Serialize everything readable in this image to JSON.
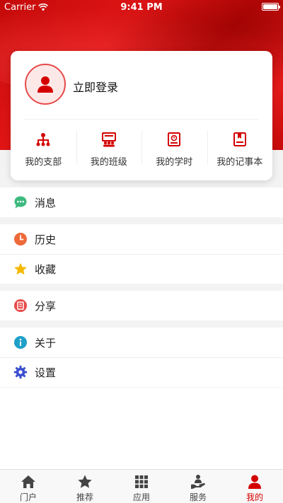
{
  "status_bar": {
    "carrier": "Carrier",
    "time": "9:41 PM"
  },
  "profile": {
    "login_label": "立即登录"
  },
  "shortcuts": [
    {
      "label": "我的支部",
      "icon": "party-emblem-icon"
    },
    {
      "label": "我的班级",
      "icon": "class-icon"
    },
    {
      "label": "我的学时",
      "icon": "study-hours-icon"
    },
    {
      "label": "我的记事本",
      "icon": "notebook-icon"
    }
  ],
  "menu": {
    "messages": {
      "label": "消息",
      "icon": "chat-bubble-icon",
      "color": "#3dba7e"
    },
    "history": {
      "label": "历史",
      "icon": "clock-icon",
      "color": "#ee6a3a"
    },
    "favorites": {
      "label": "收藏",
      "icon": "star-icon",
      "color": "#f5b800"
    },
    "share": {
      "label": "分享",
      "icon": "share-icon",
      "color": "#e94a4a"
    },
    "about": {
      "label": "关于",
      "icon": "info-icon",
      "color": "#1fa0c8"
    },
    "settings": {
      "label": "设置",
      "icon": "gear-icon",
      "color": "#3a4fd0"
    }
  },
  "tabs": [
    {
      "label": "门户",
      "icon": "home-icon"
    },
    {
      "label": "推荐",
      "icon": "star-icon"
    },
    {
      "label": "应用",
      "icon": "grid-icon"
    },
    {
      "label": "服务",
      "icon": "service-icon"
    },
    {
      "label": "我的",
      "icon": "person-icon",
      "active": true
    }
  ],
  "colors": {
    "brand_red": "#d40000",
    "tab_inactive": "#444444"
  }
}
